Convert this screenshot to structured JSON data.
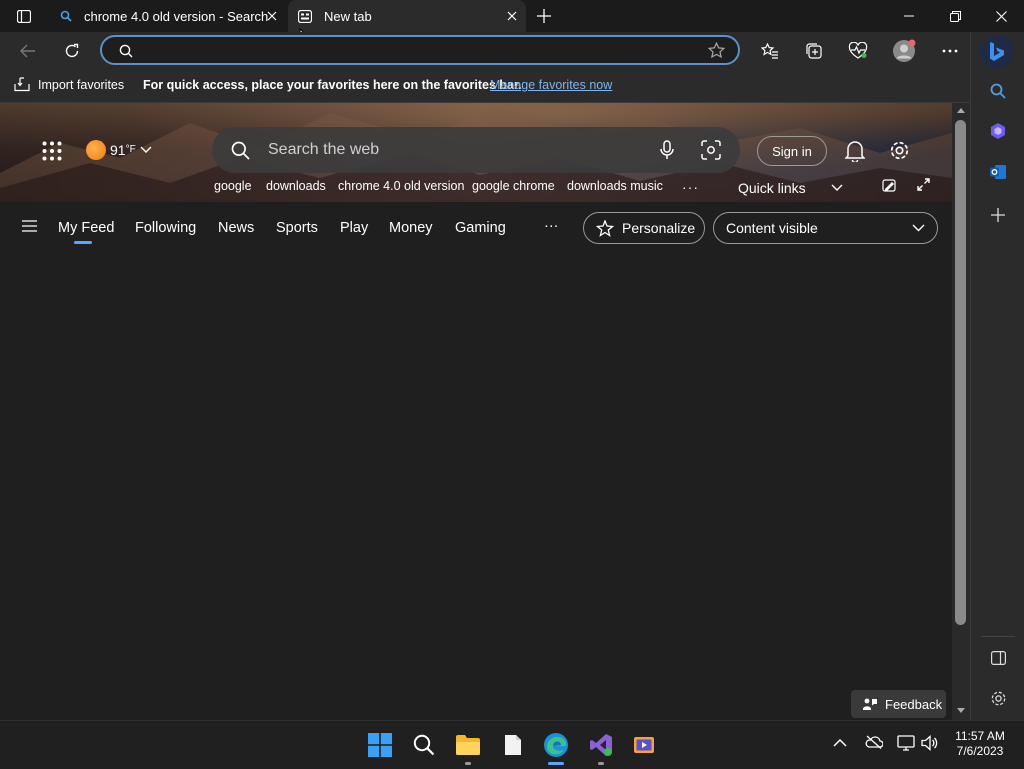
{
  "tabs": [
    {
      "title": "chrome 4.0 old version - Search",
      "icon": "search-icon",
      "active": false
    },
    {
      "title": "New tab",
      "icon": "newtab-icon",
      "active": true
    }
  ],
  "window_controls": [
    "minimize-icon",
    "restore-icon",
    "close-icon"
  ],
  "address_bar": {
    "value": "",
    "placeholder": ""
  },
  "favorites_bar": {
    "import_label": "Import favorites",
    "hint": "For quick access, place your favorites here on the favorites bar.",
    "manage_link": "Manage favorites now"
  },
  "hero": {
    "temperature": "91",
    "unit": "°F",
    "search_placeholder": "Search the web",
    "sign_in": "Sign in",
    "trending": [
      "google",
      "downloads",
      "chrome 4.0 old version",
      "google chrome",
      "downloads music"
    ],
    "quick_links": "Quick links"
  },
  "feed_nav": {
    "tabs": [
      "My Feed",
      "Following",
      "News",
      "Sports",
      "Play",
      "Money",
      "Gaming"
    ],
    "more": "···",
    "personalize": "Personalize",
    "content_visibility": "Content visible"
  },
  "feedback": "Feedback",
  "clock": {
    "time": "11:57 AM",
    "date": "7/6/2023"
  },
  "colors": {
    "accent": "#5aa6ff",
    "address_border": "#5d8fc9",
    "background": "#1f1f1f"
  }
}
